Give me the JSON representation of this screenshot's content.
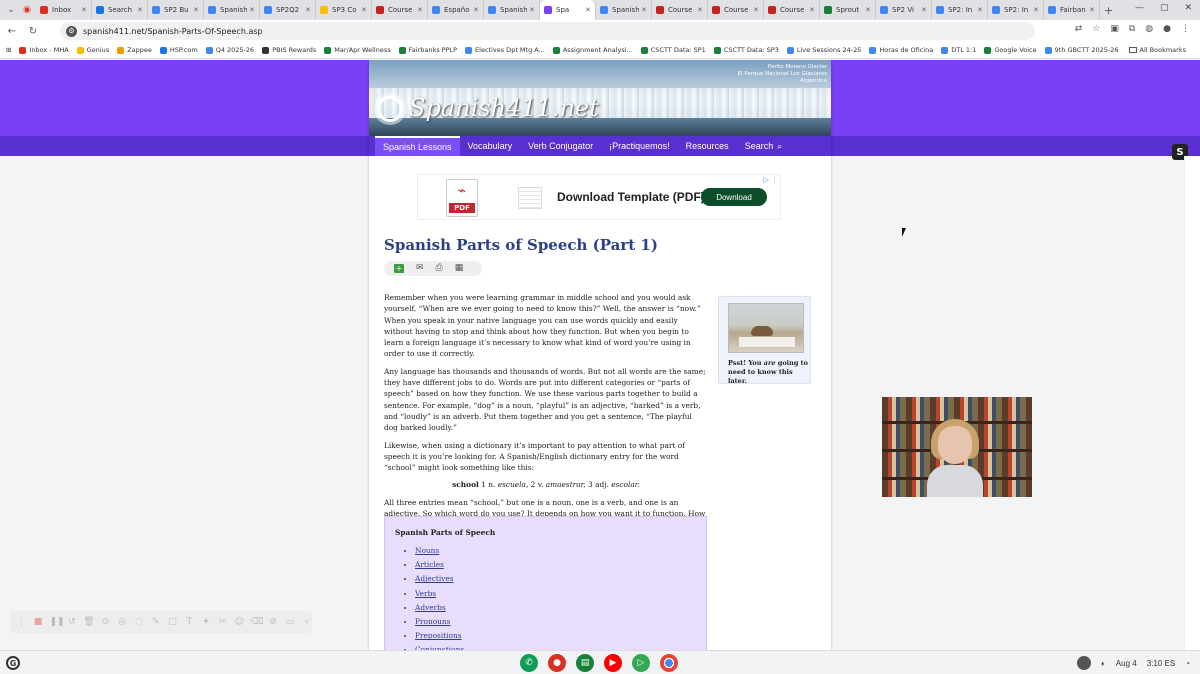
{
  "browser": {
    "tabs": [
      {
        "label": "Inbox",
        "color": "#d93025"
      },
      {
        "label": "Search",
        "color": "#1a73e8"
      },
      {
        "label": "SP2 Bu",
        "color": "#4285f4"
      },
      {
        "label": "Spanish",
        "color": "#4285f4"
      },
      {
        "label": "SP2Q2",
        "color": "#4285f4"
      },
      {
        "label": "SP3 Co",
        "color": "#fbbc04"
      },
      {
        "label": "Course",
        "color": "#c5221f"
      },
      {
        "label": "Españo",
        "color": "#4285f4"
      },
      {
        "label": "Spanish",
        "color": "#4285f4"
      },
      {
        "label": "Spa",
        "color": "#7b40f5",
        "active": true
      },
      {
        "label": "Spanish",
        "color": "#4285f4"
      },
      {
        "label": "Course",
        "color": "#c5221f"
      },
      {
        "label": "Course",
        "color": "#c5221f"
      },
      {
        "label": "Course",
        "color": "#c5221f"
      },
      {
        "label": "Sprout",
        "color": "#188038"
      },
      {
        "label": "SP2 Vi",
        "color": "#4285f4"
      },
      {
        "label": "SP2: In",
        "color": "#4285f4"
      },
      {
        "label": "SP2: In",
        "color": "#4285f4"
      },
      {
        "label": "Fairban",
        "color": "#4285f4"
      }
    ],
    "url": "spanish411.net/Spanish-Parts-Of-Speech.asp",
    "bookmarks": [
      {
        "label": "Inbox - MHA",
        "color": "#d93025"
      },
      {
        "label": "Genius",
        "color": "#fbbc04"
      },
      {
        "label": "Zappee",
        "color": "#f29900"
      },
      {
        "label": "HSP.com",
        "color": "#1a73e8"
      },
      {
        "label": "Q4 2025-26",
        "color": "#4285f4"
      },
      {
        "label": "PBIS Rewards",
        "color": "#333333"
      },
      {
        "label": "Mar/Apr Wellness",
        "color": "#188038"
      },
      {
        "label": "Fairbanks PPLP",
        "color": "#188038"
      },
      {
        "label": "Electives Dpt Mtg A...",
        "color": "#4285f4"
      },
      {
        "label": "Assignment Analysi...",
        "color": "#188038"
      },
      {
        "label": "CSCTT Data: SP1",
        "color": "#188038"
      },
      {
        "label": "CSCTT Data: SP3",
        "color": "#188038"
      },
      {
        "label": "Live Sessions 24-25",
        "color": "#4285f4"
      },
      {
        "label": "Horas de Oficina",
        "color": "#4285f4"
      },
      {
        "label": "DTL 1:1",
        "color": "#4285f4"
      },
      {
        "label": "Google Voice",
        "color": "#188038"
      },
      {
        "label": "9th GBCTT 2025-26",
        "color": "#4285f4"
      }
    ],
    "all_bookmarks": "All Bookmarks"
  },
  "site": {
    "logo": "Spanish411.net",
    "photo_credit": [
      "Perito Moreno Glacier",
      "El Parque Nacional Los Glaciares",
      "Argentina"
    ],
    "nav": [
      "Spanish Lessons",
      "Vocabulary",
      "Verb Conjugator",
      "¡Practiquemos!",
      "Resources",
      "Search"
    ],
    "ad": {
      "title": "Download Template (PDF)",
      "button": "Download",
      "pdf_label": "PDF"
    },
    "title": "Spanish Parts of Speech (Part 1)",
    "paragraphs": [
      "Remember when you were learning grammar in middle school and you would ask yourself, “When are we ever going to need to know this?” Well, the answer is “now.” When you speak in your native language you can use words quickly and easily without having to stop and think about how they function. But when you begin to learn a foreign language it’s necessary to know what kind of word you’re using in order to use it correctly.",
      "Any language has thousands and thousands of words. But not all words are the same; they have different jobs to do. Words are put into different categories or “parts of speech” based on how they function. We use these various parts together to build a sentence. For example, “dog” is a noun, “playful” is an adjective, “barked” is a verb, and “loudly” is an adverb. Put them together and you get a sentence, “The playful dog barked loudly.”",
      "Likewise, when using a dictionary it’s important to pay attention to what part of speech it is you’re looking for. A Spanish/English dictionary entry for the word “school” might look something like this:"
    ],
    "dict": {
      "word": "school",
      "e1": "1 n.",
      "w1": "escuela,",
      "e2": "2 v.",
      "w2": "amaestrar,",
      "e3": "3 adj.",
      "w3": "escolar."
    },
    "paragraph4": "All three entries mean “school,” but one is a noun, one is a verb, and one is an adjective. So which word do you use? It depends on how you want it to function. How do you know? Continue reading ...",
    "sidebar_caption_a": "Psst! You ",
    "sidebar_caption_em": "are",
    "sidebar_caption_b": " going to need to know this later.",
    "toc_title": "Spanish Parts of Speech",
    "toc_items": [
      "Nouns",
      "Articles",
      "Adjectives",
      "Verbs",
      "Adverbs",
      "Pronouns",
      "Prepositions",
      "Conjunctions"
    ]
  },
  "shelf": {
    "date": "Aug 4",
    "time": "3:10 ES",
    "launcher": "G"
  },
  "colors": {
    "purple": "#7b40f5",
    "nav": "#5a2fd0",
    "title": "#2d3f8a",
    "toc_bg": "#e9ddfd"
  }
}
